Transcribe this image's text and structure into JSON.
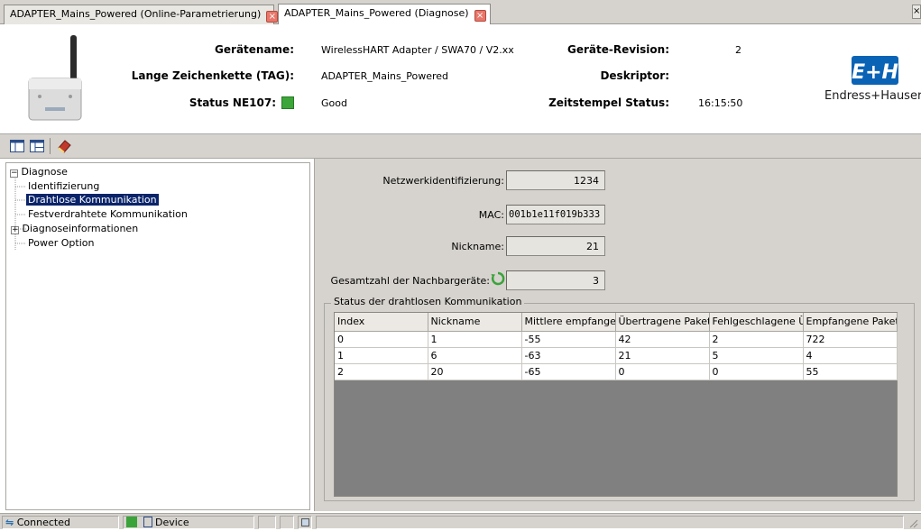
{
  "tabs": [
    {
      "label": "ADAPTER_Mains_Powered  (Online-Parametrierung)",
      "close": "×"
    },
    {
      "label": "ADAPTER_Mains_Powered  (Diagnose)",
      "close": "×"
    }
  ],
  "corner_close": "×",
  "header": {
    "geraetename_label": "Gerätename:",
    "geraetename_value": "WirelessHART Adapter / SWA70 / V2.xx",
    "tag_label": "Lange Zeichenkette (TAG):",
    "tag_value": "ADAPTER_Mains_Powered",
    "status_label": "Status NE107:",
    "status_value": "Good",
    "revision_label": "Geräte-Revision:",
    "revision_value": "2",
    "deskriptor_label": "Deskriptor:",
    "deskriptor_value": "",
    "zeitstempel_label": "Zeitstempel Status:",
    "zeitstempel_value": "16:15:50",
    "brand_logo_text": "E+H",
    "brand_name": "Endress+Hauser",
    "status_color": "#3ca63a",
    "brand_color": "#0a63b5"
  },
  "tree": {
    "root": "Diagnose",
    "root_expander": "−",
    "items": [
      {
        "label": "Identifizierung"
      },
      {
        "label": "Drahtlose Kommunikation",
        "selected": true
      },
      {
        "label": "Festverdrahtete Kommunikation"
      },
      {
        "label": "Diagnoseinformationen",
        "expander": "+"
      },
      {
        "label": "Power Option"
      }
    ]
  },
  "fields": {
    "netzwerk_label": "Netzwerkidentifizierung:",
    "netzwerk_value": "1234",
    "mac_label": "MAC:",
    "mac_value": "001b1e11f019b333",
    "nickname_label": "Nickname:",
    "nickname_value": "21",
    "nachbar_label": "Gesamtzahl der Nachbargeräte:",
    "nachbar_value": "3"
  },
  "group_title": "Status der drahtlosen Kommunikation",
  "table": {
    "columns": [
      "Index",
      "Nickname",
      "Mittlere empfange",
      "Übertragene Paket",
      "Fehlgeschlagene Ü",
      "Empfangene Paket"
    ],
    "rows": [
      [
        "0",
        "1",
        "-55",
        "42",
        "2",
        "722"
      ],
      [
        "1",
        "6",
        "-63",
        "21",
        "5",
        "4"
      ],
      [
        "2",
        "20",
        "-65",
        "0",
        "0",
        "55"
      ]
    ]
  },
  "statusbar": {
    "connected": "Connected",
    "device": "Device"
  }
}
